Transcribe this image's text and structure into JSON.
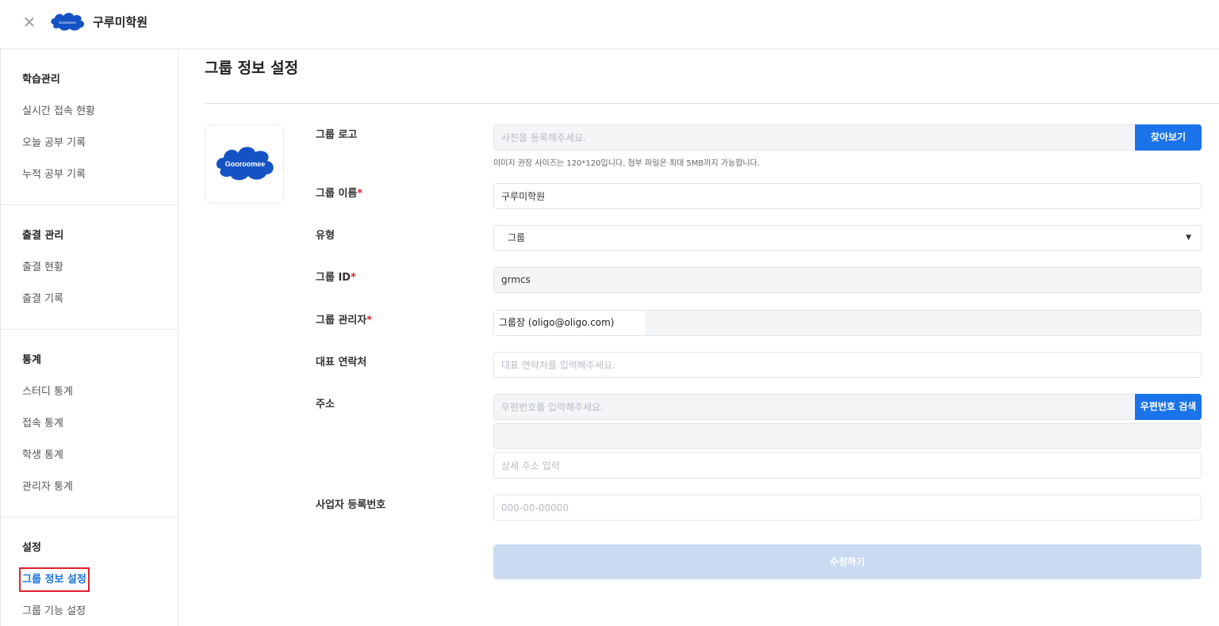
{
  "header": {
    "close_icon": "✕",
    "logo_text": "Gooroomee",
    "title": "구루미학원"
  },
  "sidebar": {
    "sections": [
      {
        "heading": "학습관리",
        "items": [
          "실시간 접속 현황",
          "오늘 공부 기록",
          "누적 공부 기록"
        ]
      },
      {
        "heading": "출결 관리",
        "items": [
          "출결 현황",
          "출결 기록"
        ]
      },
      {
        "heading": "통계",
        "items": [
          "스터디 통계",
          "접속 통계",
          "학생 통계",
          "관리자 통계"
        ]
      },
      {
        "heading": "설정",
        "items": [
          "그룹 정보 설정",
          "그룹 기능 설정"
        ]
      }
    ],
    "active_item": "그룹 정보 설정"
  },
  "main": {
    "page_title": "그룹 정보 설정",
    "logo_preview_text": "Gooroomee",
    "fields": {
      "logo": {
        "label": "그룹 로고",
        "placeholder": "사진을 등록해주세요.",
        "button": "찾아보기",
        "hint": "이미지 권장 사이즈는 120*120입니다. 첨부 파일은 최대 5MB까지 가능합니다."
      },
      "name": {
        "label": "그룹 이름",
        "required_mark": "*",
        "value": "구루미학원"
      },
      "type": {
        "label": "유형",
        "value": "그룹"
      },
      "group_id": {
        "label": "그룹 ID",
        "required_mark": "*",
        "value": "grmcs"
      },
      "admin": {
        "label": "그룹 관리자",
        "required_mark": "*",
        "value": "그룹장 (oligo@oligo.com)"
      },
      "contact": {
        "label": "대표 연락처",
        "placeholder": "대표 연락처를 입력해주세요."
      },
      "address": {
        "label": "주소",
        "zip_placeholder": "우편번호를 입력해주세요.",
        "zip_button": "우편번호 검색",
        "line1_value": "",
        "detail_placeholder": "상세 주소 입력"
      },
      "biz_no": {
        "label": "사업자 등록번호",
        "placeholder": "000-00-00000"
      }
    },
    "submit_label": "수정하기"
  },
  "colors": {
    "accent": "#1a73e8",
    "required": "#e0202b",
    "highlight_box": "#e0202b",
    "submit_disabled": "#c9daf1"
  }
}
